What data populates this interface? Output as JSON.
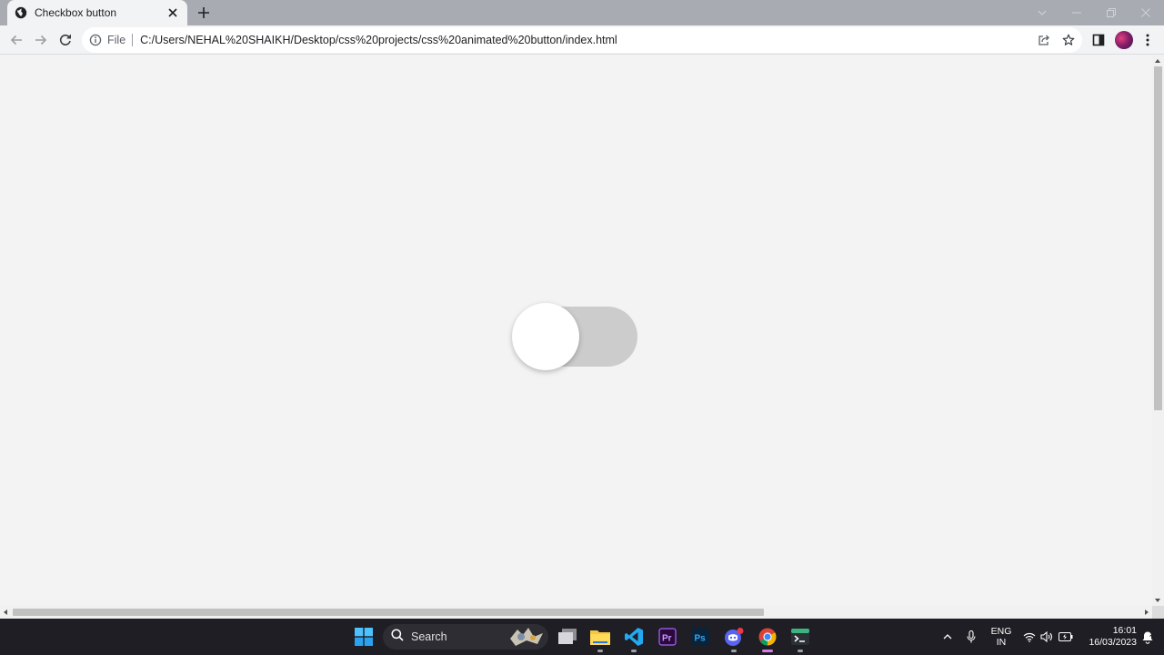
{
  "browser": {
    "tab": {
      "title": "Checkbox button"
    },
    "omnibox": {
      "scheme_label": "File",
      "url": "C:/Users/NEHAL%20SHAIKH/Desktop/css%20projects/css%20animated%20button/index.html"
    }
  },
  "page": {
    "toggle": {
      "checked": false,
      "track_color": "#cccccc",
      "knob_color": "#ffffff"
    },
    "background": "#f3f3f3"
  },
  "taskbar": {
    "search_label": "Search",
    "apps": [
      "start-icon",
      "task-view-icon",
      "file-explorer-icon",
      "vscode-icon",
      "premiere-icon",
      "photoshop-icon",
      "discord-icon",
      "chrome-icon",
      "terminal-icon"
    ],
    "language": {
      "line1": "ENG",
      "line2": "IN"
    },
    "clock": {
      "time": "16:01",
      "date": "16/03/2023"
    }
  }
}
